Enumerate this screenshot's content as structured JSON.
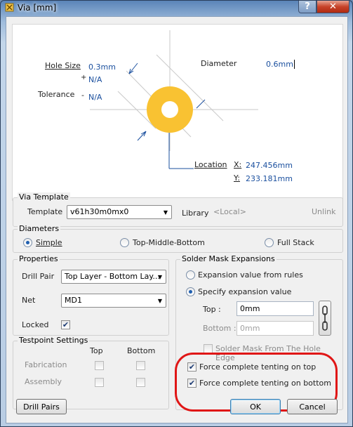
{
  "window": {
    "title": "Via [mm]",
    "help_glyph": "?",
    "close_glyph": "✕"
  },
  "preview": {
    "hole_size_label": "Hole Size",
    "hole_size_value": "0.3mm",
    "diameter_label": "Diameter",
    "diameter_value": "0.6mm",
    "tolerance_label": "Tolerance",
    "tol_plus_sign": "+",
    "tol_plus_value": "N/A",
    "tol_minus_sign": "-",
    "tol_minus_value": "N/A",
    "location_label": "Location",
    "x_label": "X:",
    "x_value": "247.456mm",
    "y_label": "Y:",
    "y_value": "233.181mm",
    "via_color": "#f9c232"
  },
  "via_template": {
    "title": "Via Template",
    "template_label": "Template",
    "template_value": "v61h30m0mx0",
    "library_label": "Library",
    "library_value": "<Local>",
    "unlink_label": "Unlink"
  },
  "diameters": {
    "title": "Diameters",
    "options": [
      "Simple",
      "Top-Middle-Bottom",
      "Full Stack"
    ],
    "selected": "Simple"
  },
  "properties": {
    "title": "Properties",
    "drill_pair_label": "Drill Pair",
    "drill_pair_value": "Top Layer - Bottom Lay...",
    "net_label": "Net",
    "net_value": "MD1",
    "locked_label": "Locked",
    "locked": true
  },
  "testpoint": {
    "title": "Testpoint Settings",
    "col_top": "Top",
    "col_bottom": "Bottom",
    "row_fab": "Fabrication",
    "row_asm": "Assembly"
  },
  "solder_mask": {
    "title": "Solder Mask Expansions",
    "opt_rules": "Expansion value from rules",
    "opt_specify": "Specify expansion value",
    "top_label": "Top :",
    "top_value": "0mm",
    "bottom_label": "Bottom :",
    "bottom_value": "0mm",
    "from_hole_edge": "Solder Mask From The Hole Edge",
    "tent_top": "Force complete tenting on top",
    "tent_bottom": "Force complete tenting on bottom"
  },
  "buttons": {
    "drill_pairs": "Drill Pairs",
    "ok": "OK",
    "cancel": "Cancel"
  },
  "colors": {
    "highlight_ring": "#e01616",
    "value_blue": "#1a4f9e"
  }
}
